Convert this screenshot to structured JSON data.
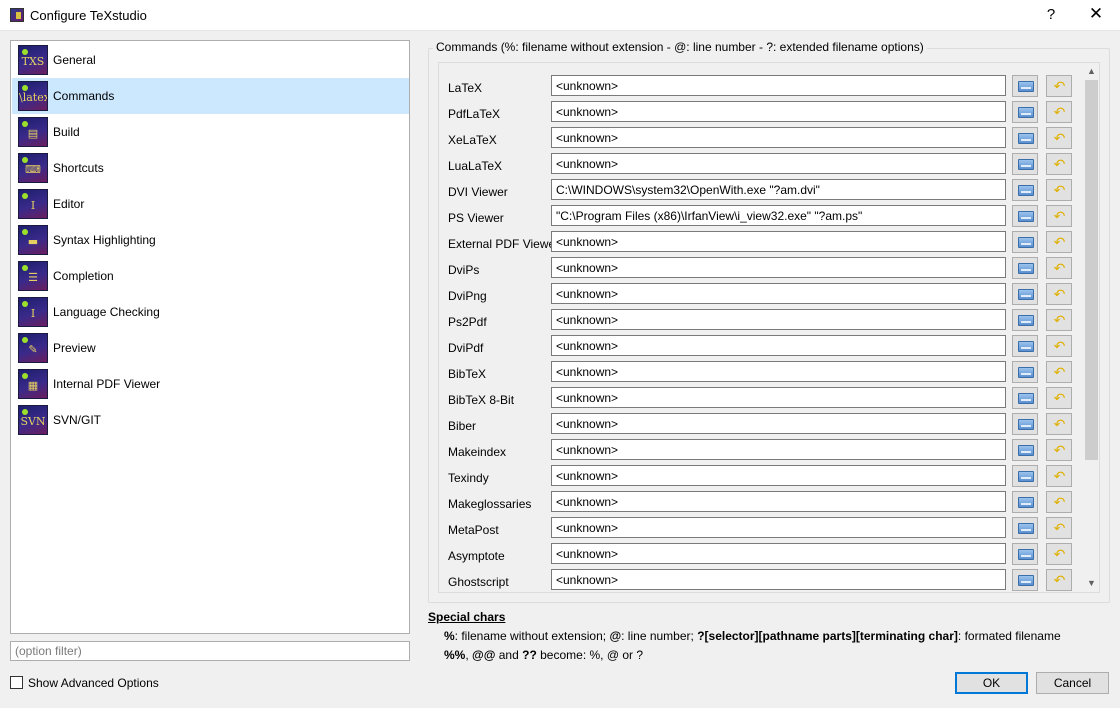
{
  "window": {
    "title": "Configure TeXstudio",
    "help_label": "?",
    "close_label": "✕"
  },
  "sidebar": {
    "items": [
      {
        "label": "General",
        "icon": "txs-logo-icon",
        "glyph": "TXS"
      },
      {
        "label": "Commands",
        "icon": "latex-command-icon",
        "glyph": "\\latex"
      },
      {
        "label": "Build",
        "icon": "build-icon",
        "glyph": "▤"
      },
      {
        "label": "Shortcuts",
        "icon": "keyboard-icon",
        "glyph": "⌨"
      },
      {
        "label": "Editor",
        "icon": "text-cursor-icon",
        "glyph": "I"
      },
      {
        "label": "Syntax Highlighting",
        "icon": "highlighter-icon",
        "glyph": "▬"
      },
      {
        "label": "Completion",
        "icon": "completion-list-icon",
        "glyph": "☰"
      },
      {
        "label": "Language Checking",
        "icon": "spellcheck-icon",
        "glyph": "I"
      },
      {
        "label": "Preview",
        "icon": "preview-icon",
        "glyph": "✎"
      },
      {
        "label": "Internal PDF Viewer",
        "icon": "pdf-viewer-icon",
        "glyph": "▦"
      },
      {
        "label": "SVN/GIT",
        "icon": "svn-icon",
        "glyph": "SVN"
      }
    ],
    "selected_index": 1
  },
  "filter": {
    "placeholder": "(option filter)"
  },
  "advanced": {
    "label": "Show Advanced Options",
    "checked": false
  },
  "commands": {
    "group_title": "Commands (%: filename without extension - @: line number - ?: extended filename options)",
    "rows": [
      {
        "label": "LaTeX",
        "value": "<unknown>"
      },
      {
        "label": "PdfLaTeX",
        "value": "<unknown>"
      },
      {
        "label": "XeLaTeX",
        "value": "<unknown>"
      },
      {
        "label": "LuaLaTeX",
        "value": "<unknown>"
      },
      {
        "label": "DVI Viewer",
        "value": "C:\\WINDOWS\\system32\\OpenWith.exe \"?am.dvi\""
      },
      {
        "label": "PS Viewer",
        "value": "\"C:\\Program Files (x86)\\IrfanView\\i_view32.exe\" \"?am.ps\""
      },
      {
        "label": "External PDF Viewer",
        "value": "<unknown>"
      },
      {
        "label": "DviPs",
        "value": "<unknown>"
      },
      {
        "label": "DviPng",
        "value": "<unknown>"
      },
      {
        "label": "Ps2Pdf",
        "value": "<unknown>"
      },
      {
        "label": "DviPdf",
        "value": "<unknown>"
      },
      {
        "label": "BibTeX",
        "value": "<unknown>"
      },
      {
        "label": "BibTeX 8-Bit",
        "value": "<unknown>"
      },
      {
        "label": "Biber",
        "value": "<unknown>"
      },
      {
        "label": "Makeindex",
        "value": "<unknown>"
      },
      {
        "label": "Texindy",
        "value": "<unknown>"
      },
      {
        "label": "Makeglossaries",
        "value": "<unknown>"
      },
      {
        "label": "MetaPost",
        "value": "<unknown>"
      },
      {
        "label": "Asymptote",
        "value": "<unknown>"
      },
      {
        "label": "Ghostscript",
        "value": "<unknown>"
      }
    ]
  },
  "special": {
    "title": "Special chars",
    "line1": [
      {
        "text": "%",
        "bold": true
      },
      {
        "text": ": filename without extension; ",
        "bold": false
      },
      {
        "text": "@",
        "bold": true
      },
      {
        "text": ": line number; ",
        "bold": false
      },
      {
        "text": "?[selector][pathname parts][terminating char]",
        "bold": true
      },
      {
        "text": ": formated filename",
        "bold": false
      }
    ],
    "line2": [
      {
        "text": "%%",
        "bold": true
      },
      {
        "text": ", ",
        "bold": false
      },
      {
        "text": "@@",
        "bold": true
      },
      {
        "text": " and ",
        "bold": false
      },
      {
        "text": "??",
        "bold": true
      },
      {
        "text": " become: %, @ or ?",
        "bold": false
      }
    ]
  },
  "buttons": {
    "ok": "OK",
    "cancel": "Cancel"
  },
  "colors": {
    "selection": "#cce8ff",
    "accent": "#0078d7"
  }
}
